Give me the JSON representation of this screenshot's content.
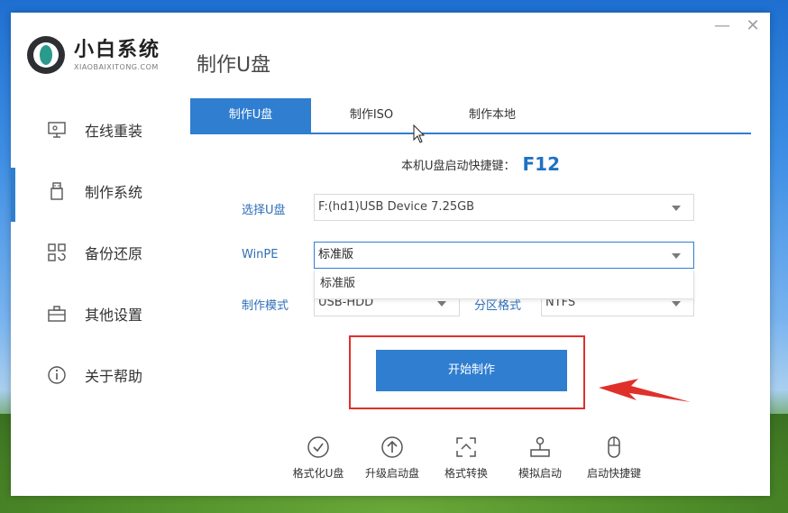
{
  "window": {
    "minimize_icon": "minimize-icon",
    "close_icon": "close-icon"
  },
  "logo": {
    "title": "小白系统",
    "subtitle": "XIAOBAIXITONG.COM"
  },
  "page_title": "制作U盘",
  "sidebar": {
    "items": [
      {
        "label": "在线重装",
        "icon": "monitor-icon"
      },
      {
        "label": "制作系统",
        "icon": "usb-drive-icon",
        "active": true
      },
      {
        "label": "备份还原",
        "icon": "grid-restore-icon"
      },
      {
        "label": "其他设置",
        "icon": "briefcase-icon"
      },
      {
        "label": "关于帮助",
        "icon": "info-icon"
      }
    ]
  },
  "tabs": [
    {
      "label": "制作U盘",
      "active": true
    },
    {
      "label": "制作ISO"
    },
    {
      "label": "制作本地"
    }
  ],
  "hotkey": {
    "label": "本机U盘启动快捷键：",
    "key": "F12"
  },
  "form": {
    "usb_label": "选择U盘",
    "usb_value": "F:(hd1)USB Device 7.25GB",
    "winpe_label": "WinPE",
    "winpe_value": "标准版",
    "winpe_dropdown_option": "标准版",
    "mode_label": "制作模式",
    "mode_value": "USB-HDD",
    "partition_label": "分区格式",
    "partition_value": "NTFS"
  },
  "start_button": "开始制作",
  "tools": [
    {
      "label": "格式化U盘",
      "icon": "check-circle-icon"
    },
    {
      "label": "升级启动盘",
      "icon": "arrow-up-circle-icon"
    },
    {
      "label": "格式转换",
      "icon": "convert-icon"
    },
    {
      "label": "模拟启动",
      "icon": "joystick-icon"
    },
    {
      "label": "启动快捷键",
      "icon": "mouse-icon"
    }
  ],
  "colors": {
    "accent": "#2f7ed0",
    "highlight": "#e0302a"
  }
}
